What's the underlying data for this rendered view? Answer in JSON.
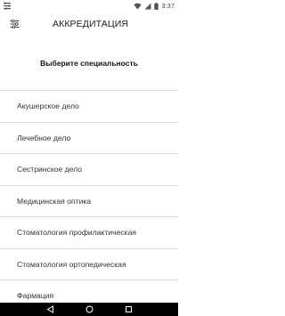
{
  "status_bar": {
    "time": "3:37",
    "icons": [
      "sliders-icon",
      "wifi-icon",
      "cellular-icon",
      "battery-icon"
    ]
  },
  "app_bar": {
    "title": "АККРЕДИТАЦИЯ",
    "menu_icon": "tune-icon"
  },
  "header": {
    "title": "Выберите специальность"
  },
  "specialties": [
    "Акушерское дело",
    "Лечебное дело",
    "Сестринское дело",
    "Медицинская оптика",
    "Стоматология профилактическая",
    "Стоматология ортопедическая",
    "Фармация"
  ],
  "nav_bar": {
    "icons": [
      "back-icon",
      "home-icon",
      "recents-icon"
    ]
  },
  "colors": {
    "background": "#ffffff",
    "divider": "#dcdcdc",
    "text": "#333333",
    "nav_bar": "#000000"
  }
}
